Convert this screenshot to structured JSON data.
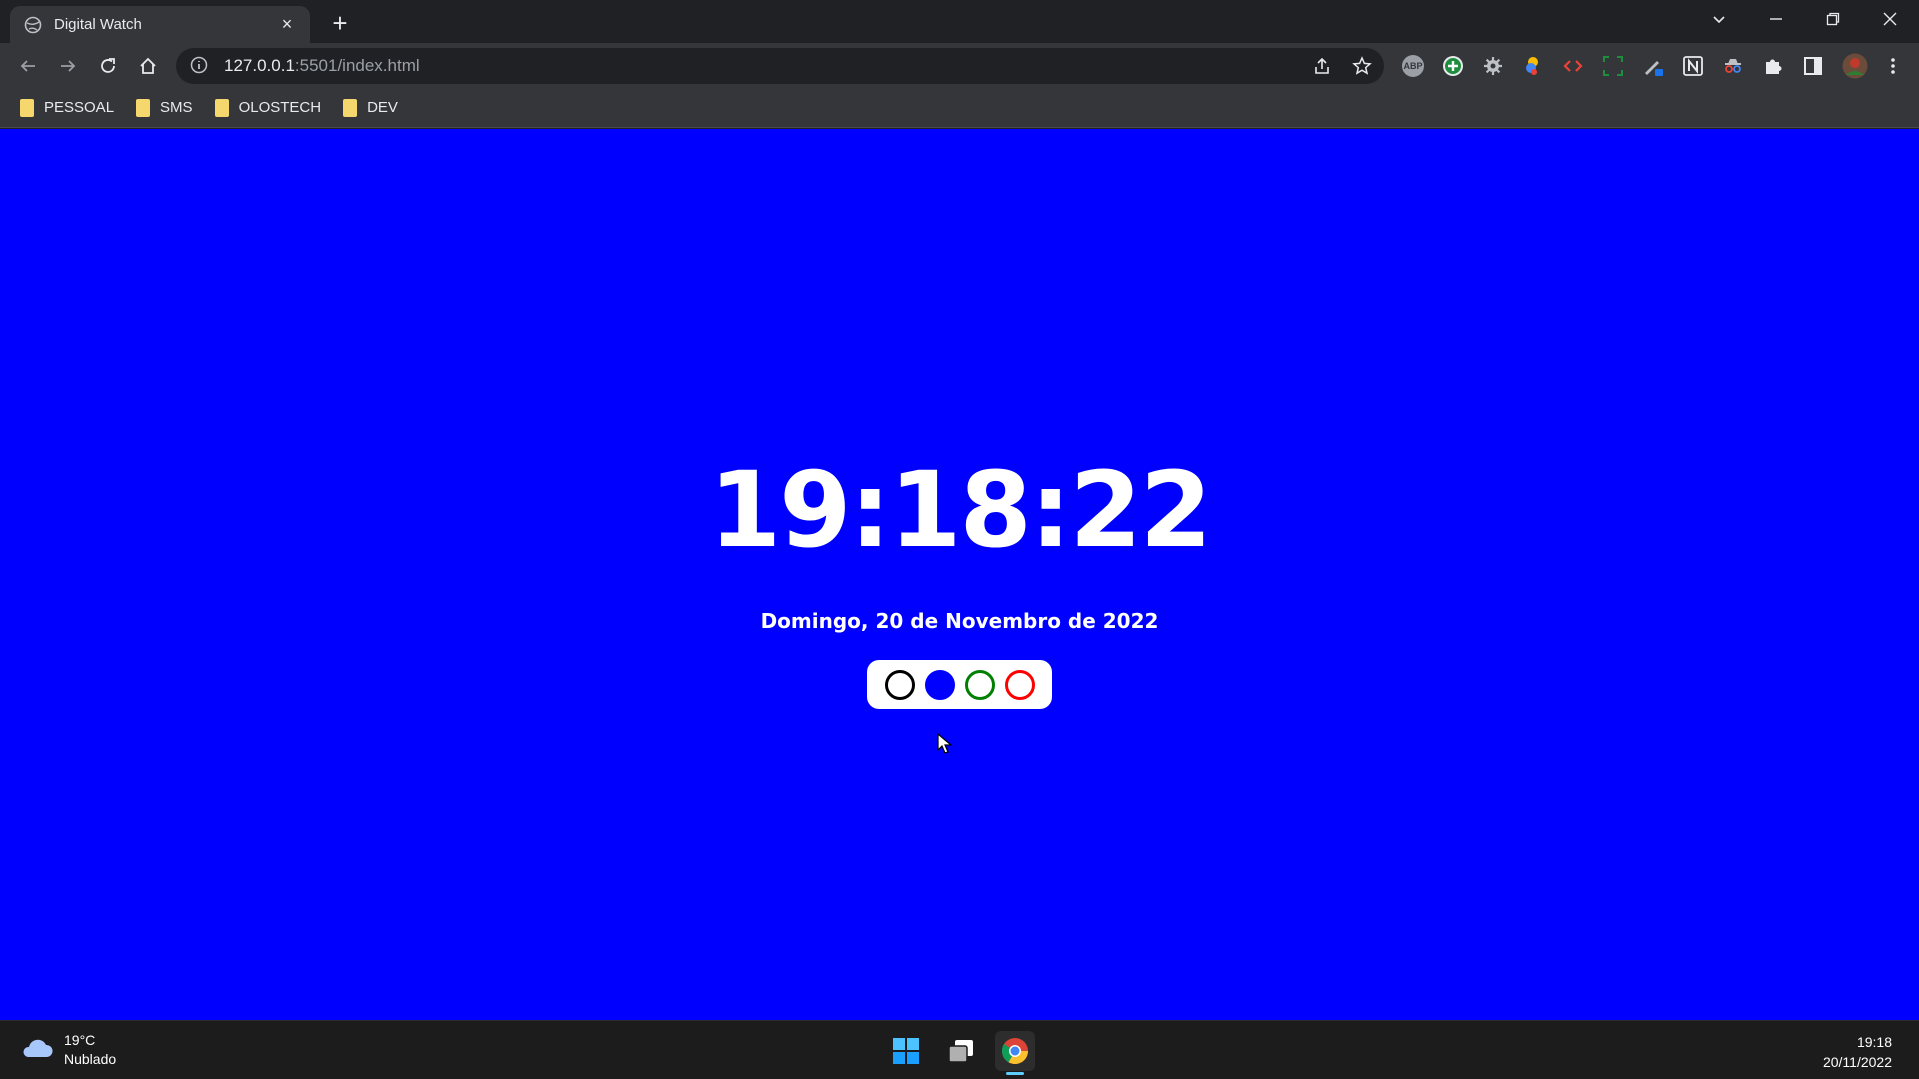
{
  "browser": {
    "tab_title": "Digital Watch",
    "url_host": "127.0.0.1",
    "url_rest": ":5501/index.html",
    "bookmarks": [
      "PESSOAL",
      "SMS",
      "OLOSTECH",
      "DEV"
    ],
    "extensions": [
      "ABP"
    ]
  },
  "page": {
    "background_color": "#0000ff",
    "time": "19:18:22",
    "date": "Domingo, 20 de Novembro de 2022",
    "color_options": [
      {
        "name": "black",
        "color": "#000000",
        "selected": false
      },
      {
        "name": "blue",
        "color": "#0000ff",
        "selected": true
      },
      {
        "name": "green",
        "color": "#008000",
        "selected": false
      },
      {
        "name": "red",
        "color": "#ff0000",
        "selected": false
      }
    ]
  },
  "taskbar": {
    "weather_temp": "19°C",
    "weather_desc": "Nublado",
    "time": "19:18",
    "date": "20/11/2022"
  }
}
